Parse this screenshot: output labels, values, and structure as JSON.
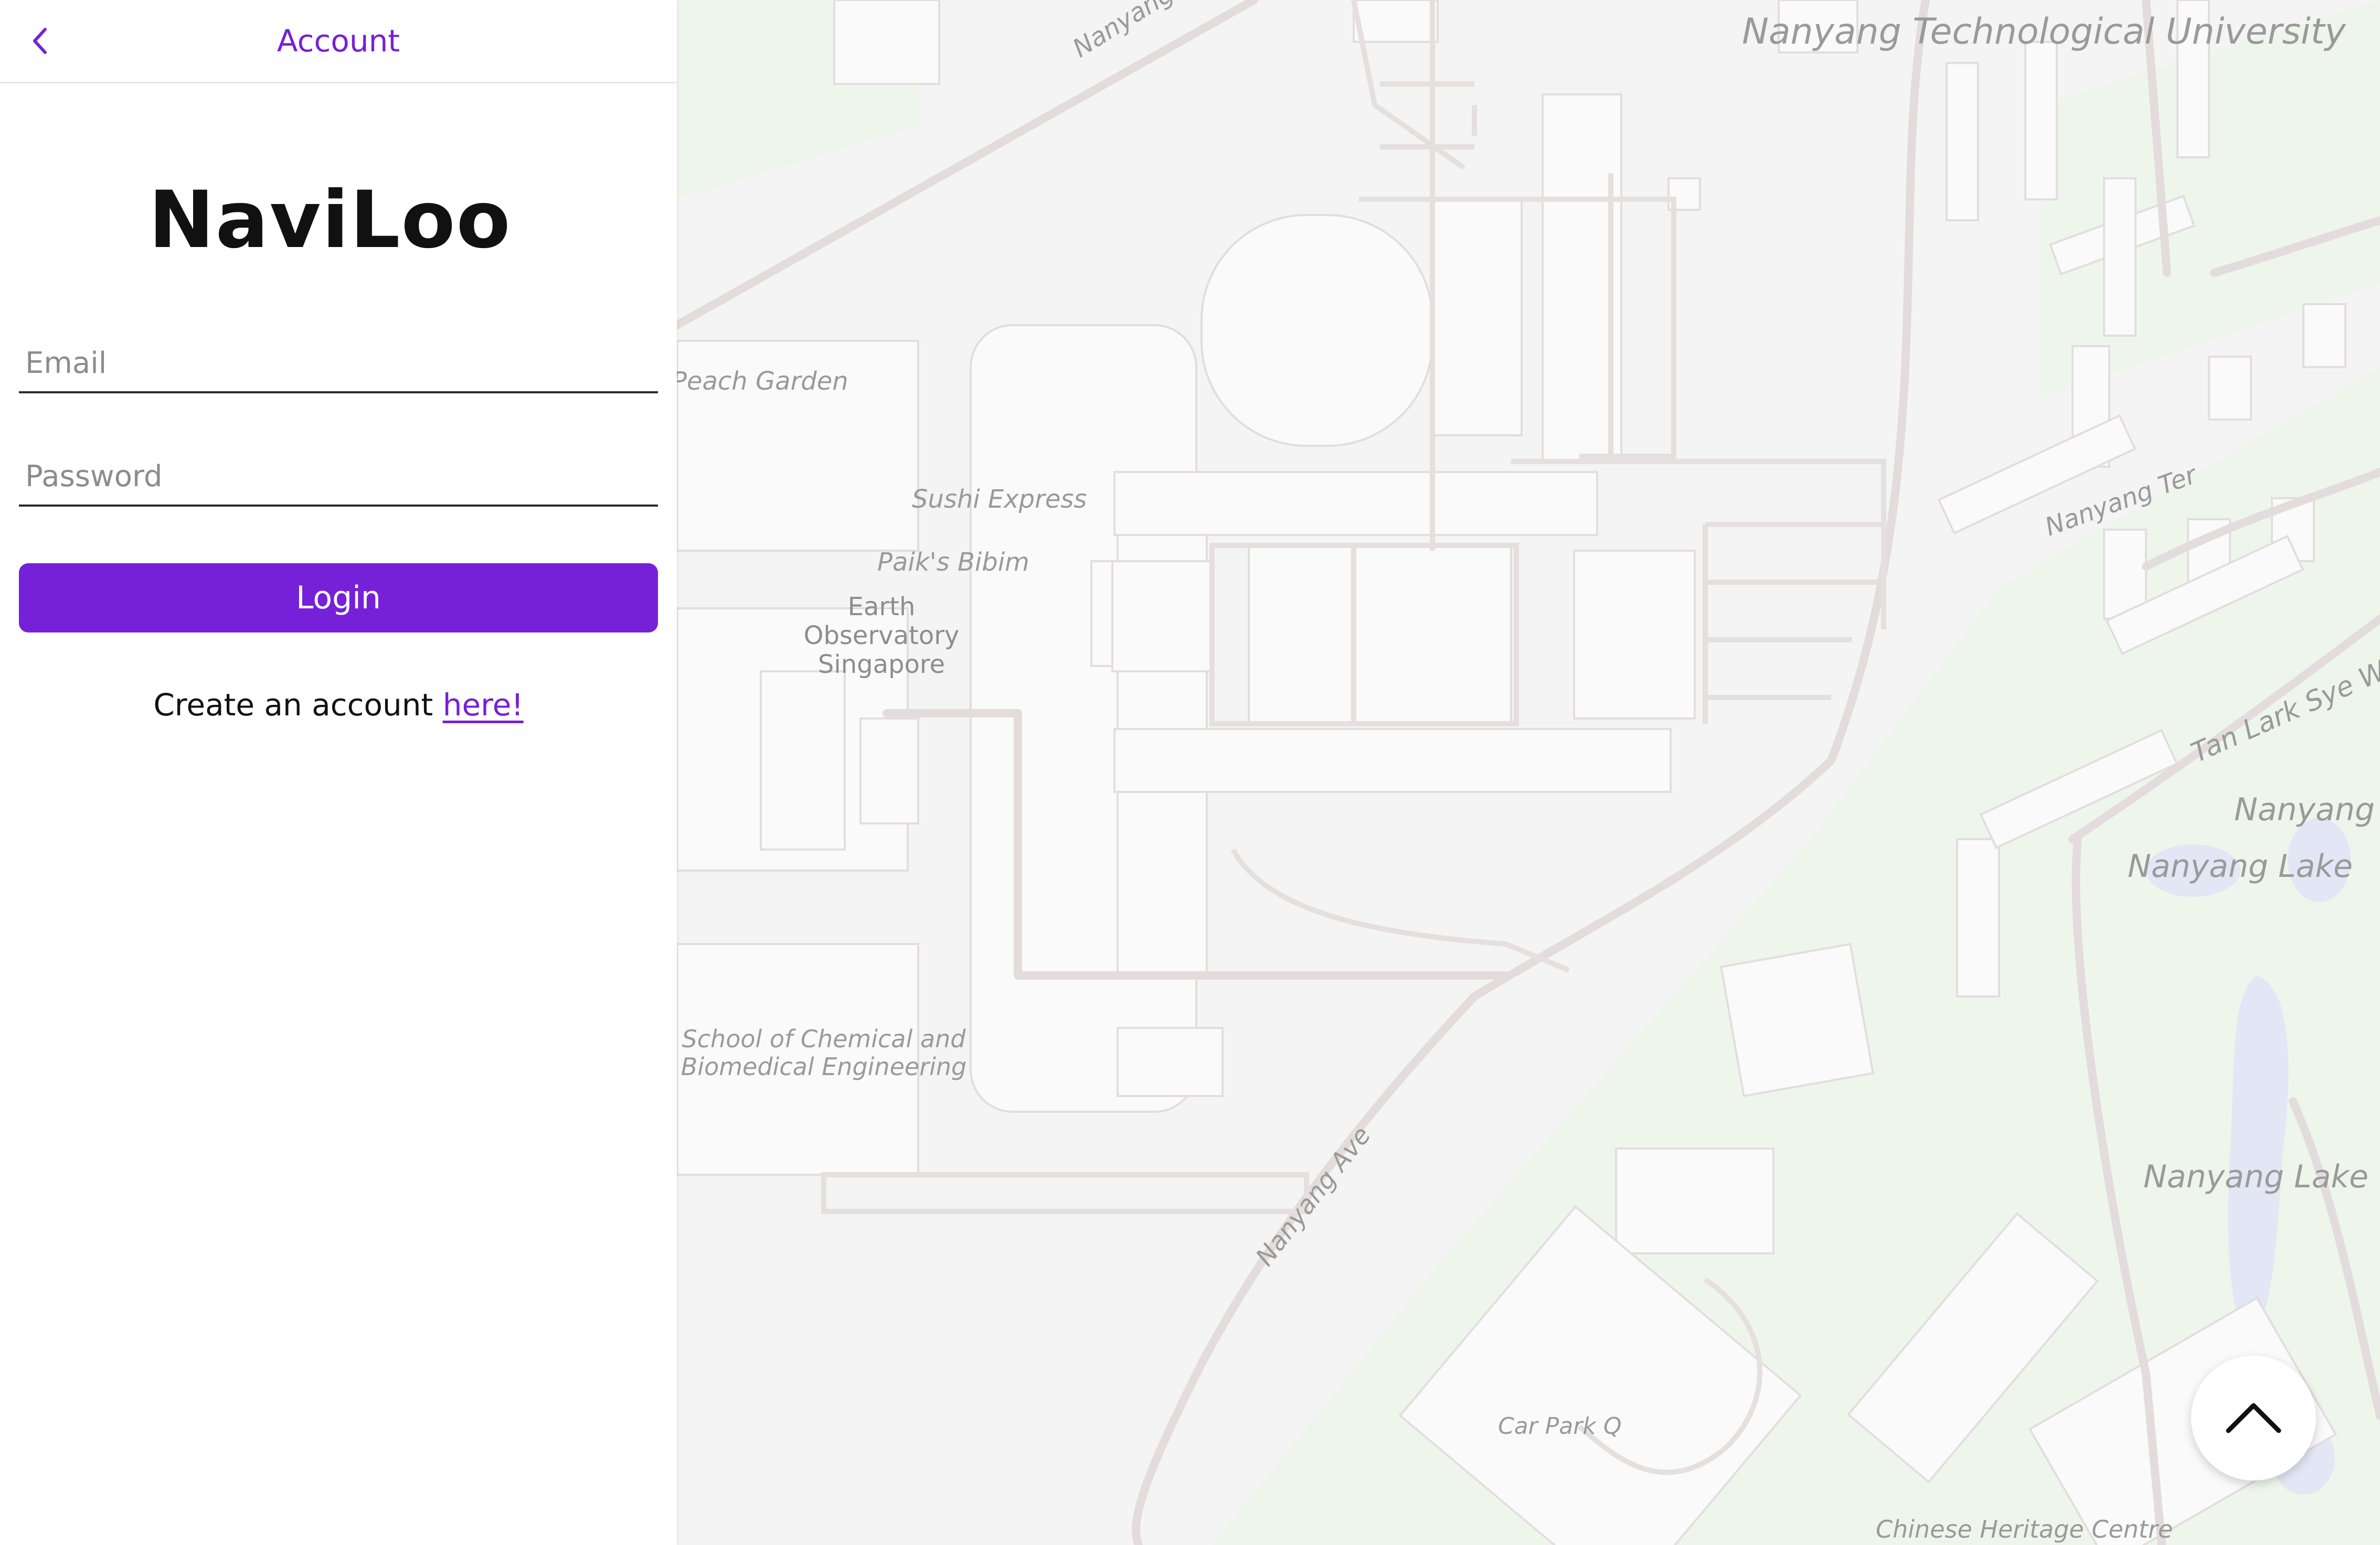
{
  "header": {
    "title": "Account",
    "back_icon": "chevron-left-icon"
  },
  "logo": {
    "text": "NaviLoo"
  },
  "form": {
    "email_placeholder": "Email",
    "email_value": "",
    "password_placeholder": "Password",
    "password_value": "",
    "login_label": "Login",
    "create_prefix": "Create an account ",
    "create_link": "here!"
  },
  "map": {
    "labels": {
      "ntu": "Nanyang Technological University",
      "nanyang_dr": "Nanyang Dr",
      "peach_garden": "Peach Garden",
      "sushi_express": "Sushi Express",
      "paiks_bibim": "Paik's Bibim",
      "earth_obs": "Earth Observatory Singapore",
      "scbe": "School of Chemical and Biomedical Engineering",
      "nanyang_ter": "Nanyang Ter",
      "tan_lark_sye": "Tan Lark Sye Wa",
      "nanyang_lake_1": "Nanyang Lake",
      "nanyang_lake_2": "Nanyang Lake",
      "nanyang_lake_3": "Nanyang L",
      "nanyang_ave": "Nanyang Ave",
      "car_park_q": "Car Park Q",
      "chinese_heritage": "Chinese Heritage Centre"
    }
  },
  "scroll_up_icon": "chevron-up-icon",
  "colors": {
    "accent": "#7620d8",
    "map_background": "#f4f4f4",
    "map_green": "#eef6ec",
    "map_water": "#e3e6f4"
  }
}
